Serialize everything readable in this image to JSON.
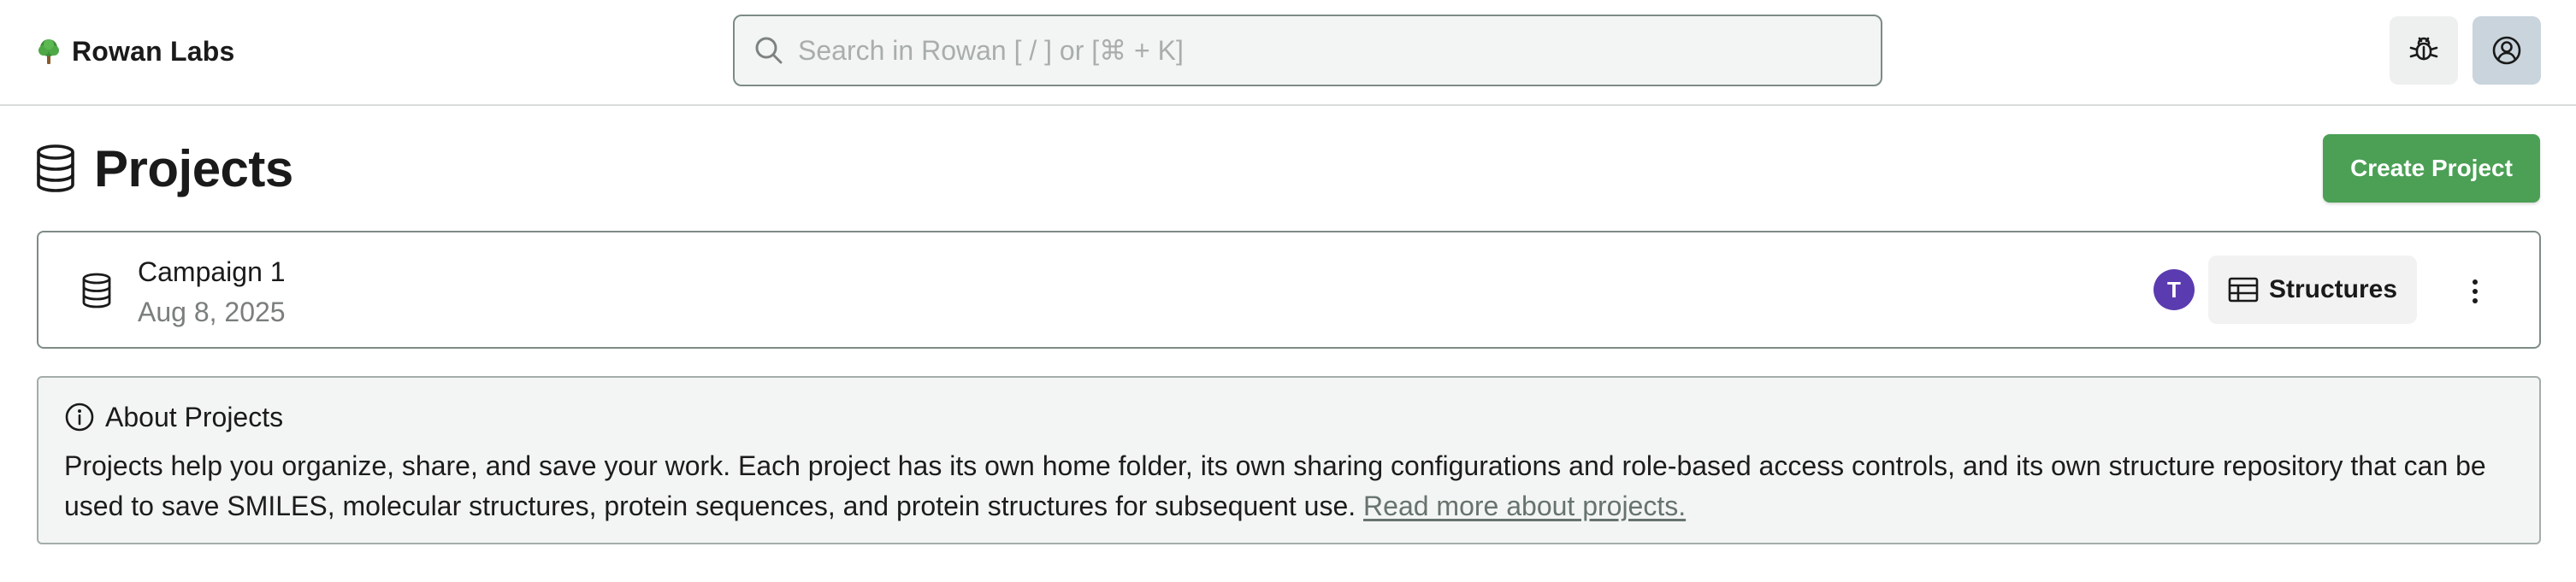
{
  "header": {
    "brand_name": "Rowan Labs",
    "brand_logo_icon": "tree-icon",
    "search": {
      "placeholder": "Search in Rowan [ / ] or [⌘ + K]",
      "value": "",
      "icon": "search-icon"
    },
    "actions": [
      {
        "name": "bug-report",
        "icon": "bug-icon"
      },
      {
        "name": "account",
        "icon": "user-circle-icon"
      }
    ]
  },
  "page": {
    "title": "Projects",
    "title_icon": "database-icon",
    "create_button_label": "Create Project"
  },
  "projects": [
    {
      "name": "Campaign 1",
      "date": "Aug 8, 2025",
      "icon": "database-icon",
      "owner_initial": "T",
      "structures_label": "Structures",
      "structures_icon": "table-icon",
      "menu_icon": "kebab-icon"
    }
  ],
  "about": {
    "title": "About Projects",
    "icon": "info-icon",
    "body": "Projects help you organize, share, and save your work. Each project has its own home folder, its own sharing configurations and role-based access controls, and its own structure repository that can be used to save SMILES, molecular structures, protein sequences, and protein structures for subsequent use.",
    "link_text": "Read more about projects."
  },
  "colors": {
    "accent_green": "#4ba055",
    "avatar_purple": "#5b3bb0",
    "card_border": "#7e8c85",
    "about_background": "#f3f5f4"
  }
}
